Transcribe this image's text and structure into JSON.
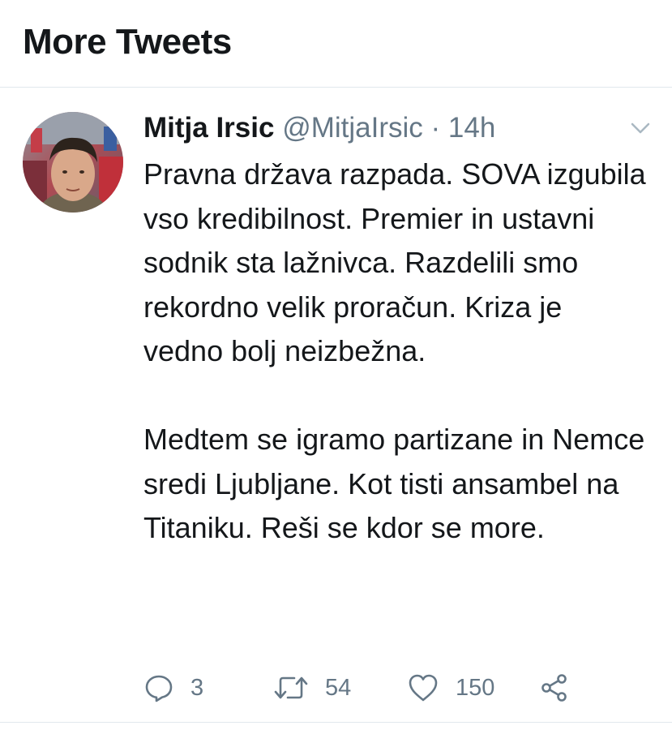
{
  "header": {
    "title": "More Tweets"
  },
  "tweet": {
    "author_name": "Mitja Irsic",
    "author_handle": "@MitjaIrsic",
    "separator": "·",
    "timestamp": "14h",
    "text": "Pravna država razpada. SOVA izgubila vso kredibilnost. Premier in ustavni sodnik sta lažnivca. Razdelili smo rekordno velik proračun. Kriza je vedno bolj neizbežna.\n\nMedtem se igramo partizane in Nemce sredi Ljubljane. Kot tisti ansambel na Titaniku. Reši se kdor se more.",
    "actions": {
      "reply_count": "3",
      "retweet_count": "54",
      "like_count": "150"
    }
  },
  "icons": {
    "caret": "chevron-down-icon",
    "reply": "reply-icon",
    "retweet": "retweet-icon",
    "like": "heart-icon",
    "share": "share-icon"
  },
  "colors": {
    "text_primary": "#14171a",
    "text_secondary": "#657786",
    "divider": "#e1e8ed"
  }
}
